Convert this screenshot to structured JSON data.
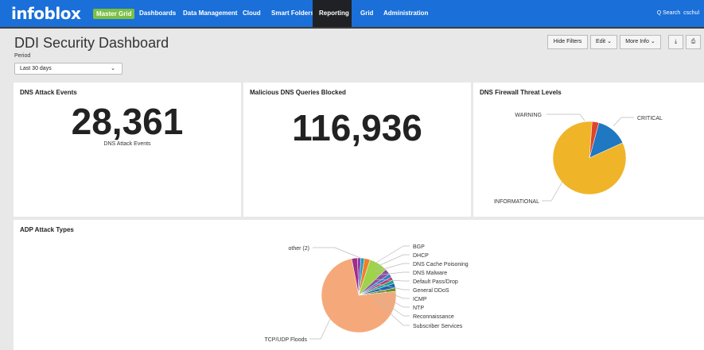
{
  "header": {
    "logo": "infoblox",
    "grid_badge": "Master Grid",
    "nav": [
      "Dashboards",
      "Data Management",
      "Cloud",
      "Smart Folders",
      "Reporting",
      "Grid",
      "Administration"
    ],
    "active_nav": "Reporting",
    "search": "Q Search",
    "user": "cschul"
  },
  "page": {
    "title": "DDI Security Dashboard",
    "period_label": "Period",
    "period_value": "Last 30 days",
    "buttons": {
      "hide_filters": "Hide Filters",
      "edit": "Edit",
      "more_info": "More Info",
      "download": "⤓",
      "print": "⎙"
    }
  },
  "panels": {
    "dns_attack": {
      "title": "DNS Attack Events",
      "value": "28,361",
      "label": "DNS Attack Events"
    },
    "malicious": {
      "title": "Malicious DNS Queries Blocked",
      "value": "116,936"
    },
    "firewall": {
      "title": "DNS Firewall Threat Levels"
    },
    "adp": {
      "title": "ADP Attack Types"
    }
  },
  "chart_data": [
    {
      "type": "pie",
      "title": "DNS Firewall Threat Levels",
      "slices": [
        {
          "label": "CRITICAL",
          "value": 14,
          "color": "#1f78c1"
        },
        {
          "label": "INFORMATIONAL",
          "value": 83,
          "color": "#f0b429"
        },
        {
          "label": "WARNING",
          "value": 3,
          "color": "#e0442b"
        }
      ]
    },
    {
      "type": "pie",
      "title": "ADP Attack Types",
      "slices": [
        {
          "label": "BGP",
          "value": 1.5,
          "color": "#8c3fa8"
        },
        {
          "label": "DHCP",
          "value": 1.5,
          "color": "#1e9fb6"
        },
        {
          "label": "DNS Cache Poisoning",
          "value": 2.5,
          "color": "#f07f2c"
        },
        {
          "label": "DNS Malware",
          "value": 8,
          "color": "#9ed34a"
        },
        {
          "label": "Default Pass/Drop",
          "value": 2.5,
          "color": "#8d4ea3"
        },
        {
          "label": "General DDoS",
          "value": 1.5,
          "color": "#2a7fc9"
        },
        {
          "label": "ICMP",
          "value": 1.5,
          "color": "#c0376b"
        },
        {
          "label": "NTP",
          "value": 1.5,
          "color": "#15a58d"
        },
        {
          "label": "Reconnaissance",
          "value": 2,
          "color": "#1f5fb0"
        },
        {
          "label": "Subscriber Services",
          "value": 1.5,
          "color": "#6b8e23"
        },
        {
          "label": "TCP/UDP Floods",
          "value": 74,
          "color": "#f5a97a"
        },
        {
          "label": "other (2)",
          "value": 2.5,
          "color": "#9c2f86"
        }
      ]
    }
  ]
}
